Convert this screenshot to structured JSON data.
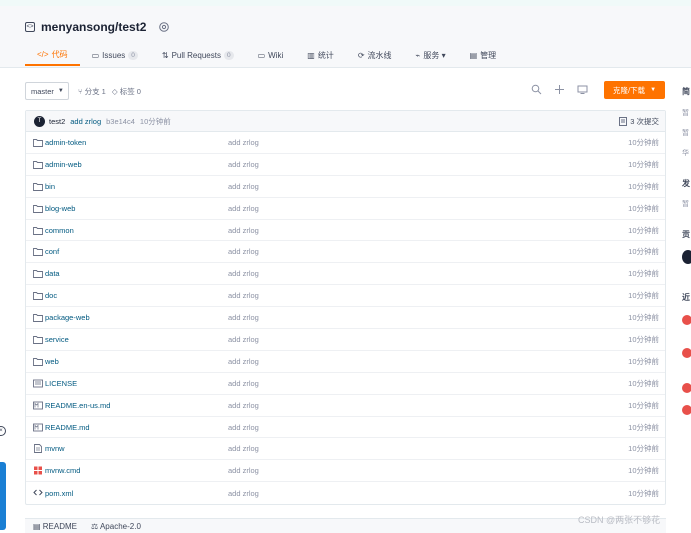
{
  "repo": {
    "title": "menyansong/test2"
  },
  "tabs": [
    {
      "label": "代码",
      "icon": "code-icon",
      "active": true
    },
    {
      "label": "Issues",
      "count": "0",
      "icon": "issues-icon"
    },
    {
      "label": "Pull Requests",
      "count": "0",
      "icon": "pull-request-icon"
    },
    {
      "label": "Wiki",
      "icon": "wiki-icon"
    },
    {
      "label": "统计",
      "icon": "stats-icon"
    },
    {
      "label": "流水线",
      "icon": "pipeline-icon"
    },
    {
      "label": "服务 ▾",
      "icon": "service-icon"
    },
    {
      "label": "管理",
      "icon": "manage-icon"
    }
  ],
  "branch": {
    "name": "master",
    "branches": "分支 1",
    "tags": "标签 0"
  },
  "clone_button": "克隆/下载",
  "commit": {
    "avatar": "T",
    "user": "test2",
    "message": "add zrlog",
    "hash": "b3e14c4",
    "time": "10分钟前",
    "count": "3 次提交"
  },
  "files": [
    {
      "name": "admin-token",
      "type": "folder",
      "msg": "add zrlog",
      "time": "10分钟前"
    },
    {
      "name": "admin-web",
      "type": "folder",
      "msg": "add zrlog",
      "time": "10分钟前"
    },
    {
      "name": "bin",
      "type": "folder",
      "msg": "add zrlog",
      "time": "10分钟前"
    },
    {
      "name": "blog-web",
      "type": "folder",
      "msg": "add zrlog",
      "time": "10分钟前"
    },
    {
      "name": "common",
      "type": "folder",
      "msg": "add zrlog",
      "time": "10分钟前"
    },
    {
      "name": "conf",
      "type": "folder",
      "msg": "add zrlog",
      "time": "10分钟前"
    },
    {
      "name": "data",
      "type": "folder",
      "msg": "add zrlog",
      "time": "10分钟前"
    },
    {
      "name": "doc",
      "type": "folder",
      "msg": "add zrlog",
      "time": "10分钟前"
    },
    {
      "name": "package-web",
      "type": "folder",
      "msg": "add zrlog",
      "time": "10分钟前"
    },
    {
      "name": "service",
      "type": "folder",
      "msg": "add zrlog",
      "time": "10分钟前"
    },
    {
      "name": "web",
      "type": "folder",
      "msg": "add zrlog",
      "time": "10分钟前"
    },
    {
      "name": "LICENSE",
      "type": "license",
      "msg": "add zrlog",
      "time": "10分钟前"
    },
    {
      "name": "README.en-us.md",
      "type": "markdown",
      "msg": "add zrlog",
      "time": "10分钟前"
    },
    {
      "name": "README.md",
      "type": "markdown",
      "msg": "add zrlog",
      "time": "10分钟前"
    },
    {
      "name": "mvnw",
      "type": "file",
      "msg": "add zrlog",
      "time": "10分钟前"
    },
    {
      "name": "mvnw.cmd",
      "type": "windows",
      "msg": "add zrlog",
      "time": "10分钟前"
    },
    {
      "name": "pom.xml",
      "type": "code",
      "msg": "add zrlog",
      "time": "10分钟前"
    }
  ],
  "bottom_tabs": {
    "readme": "README",
    "license": "Apache-2.0"
  },
  "sidebar": {
    "h1": "简",
    "g1": "暂",
    "g2": "暂",
    "g3": "华",
    "h2": "发",
    "g4": "暂",
    "h3": "贡",
    "h4": "近"
  },
  "watermark": "CSDN @两张不够花",
  "colors": {
    "accent": "#fe7300",
    "link": "#005980",
    "muted": "#8c92a4"
  }
}
